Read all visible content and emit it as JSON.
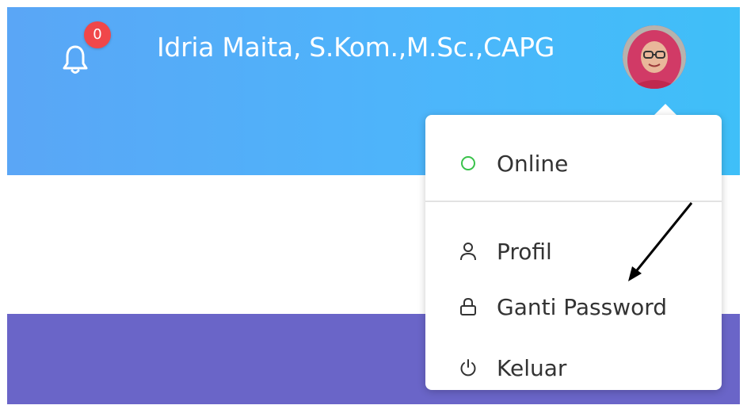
{
  "header": {
    "notification_count": "0",
    "user_name": "Idria Maita, S.Kom.,M.Sc.,CAPG",
    "icons": {
      "notifications": "bell-icon",
      "avatar": "user-avatar"
    }
  },
  "dropdown": {
    "status": {
      "label": "Online",
      "icon": "status-circle-icon",
      "color": "#39c24a"
    },
    "items": [
      {
        "label": "Profil",
        "icon": "user-icon"
      },
      {
        "label": "Ganti Password",
        "icon": "lock-icon"
      },
      {
        "label": "Keluar",
        "icon": "power-icon"
      }
    ]
  },
  "colors": {
    "header_gradient_start": "#5aa6f6",
    "header_gradient_end": "#3fbff8",
    "band": "#6a65c8",
    "badge": "#f0474a",
    "annotation_arrow": "#000000"
  }
}
